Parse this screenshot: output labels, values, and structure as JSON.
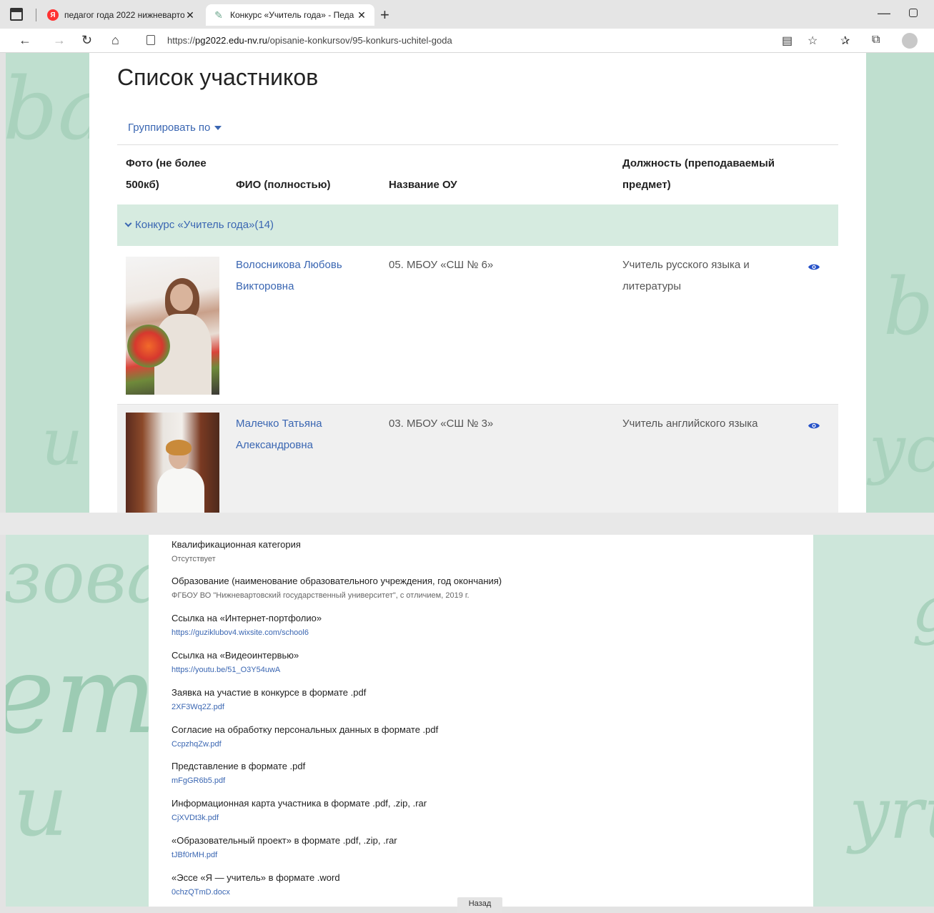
{
  "browser": {
    "tabs": [
      {
        "title": "педагог года 2022 нижневарто",
        "favicon": "yandex-icon",
        "active": false
      },
      {
        "title": "Конкурс «Учитель года» - Педа",
        "favicon": "pen-icon",
        "active": true
      }
    ],
    "url_prefix": "https://",
    "url_host": "pg2022.edu-nv.ru",
    "url_path": "/opisanie-konkursov/95-konkurs-uchitel-goda"
  },
  "page": {
    "title": "Список участников",
    "group_by": "Группировать по",
    "headers": {
      "photo": "Фото (не более 500кб)",
      "fio": "ФИО (полностью)",
      "ou": "Название ОУ",
      "post": "Должность (преподаваемый предмет)"
    },
    "group": {
      "label": "Конкурс «Учитель года»(14)"
    },
    "rows": [
      {
        "fio": "Волосникова Любовь Викторовна",
        "ou": "05. МБОУ «СШ № 6»",
        "post": "Учитель русского языка и литературы"
      },
      {
        "fio": "Малечко Татьяна Александровна",
        "ou": "03. МБОУ «СШ № 3»",
        "post": "Учитель английского языка"
      }
    ]
  },
  "details": {
    "fields": [
      {
        "label": "Квалификационная категория",
        "value": "Отсутствует",
        "is_link": false
      },
      {
        "label": "Образование (наименование образовательного учреждения, год окончания)",
        "value": "ФГБОУ ВО \"Нижневартовский государственный университет\", с отличием, 2019 г.",
        "is_link": false
      },
      {
        "label": "Ссылка на «Интернет-портфолио»",
        "value": "https://guziklubov4.wixsite.com/school6",
        "is_link": true
      },
      {
        "label": "Ссылка на «Видеоинтервью»",
        "value": "https://youtu.be/51_O3Y54uwA",
        "is_link": true
      },
      {
        "label": "Заявка на участие в конкурсе в формате .pdf",
        "value": "2XF3Wq2Z.pdf",
        "is_link": true
      },
      {
        "label": "Согласие на обработку персональных данных в формате .pdf",
        "value": "CcpzhqZw.pdf",
        "is_link": true
      },
      {
        "label": "Представление в формате .pdf",
        "value": "mFgGR6b5.pdf",
        "is_link": true
      },
      {
        "label": "Информационная карта участника в формате .pdf, .zip, .rar",
        "value": "CjXVDt3k.pdf",
        "is_link": true
      },
      {
        "label": "«Образовательный проект» в формате .pdf, .zip, .rar",
        "value": "tJBf0rMH.pdf",
        "is_link": true
      },
      {
        "label": "«Эссе «Я — учитель» в формате .word",
        "value": "0chzQTmD.docx",
        "is_link": true
      }
    ],
    "close_button": "Назад"
  },
  "decor": {
    "top_left_script": "ba",
    "top_left_script2": "u",
    "top_right_script": "b",
    "top_right_script2": "yc",
    "bottom_left_script": "зоваu",
    "bottom_left_script2": "emu",
    "bottom_left_script3": "u",
    "bottom_right_script": "yru",
    "bottom_right_script2": "g"
  },
  "colors": {
    "link": "#3a66b2",
    "background_green": "#bfdfcf",
    "group_row_green": "#d6ebe0"
  }
}
